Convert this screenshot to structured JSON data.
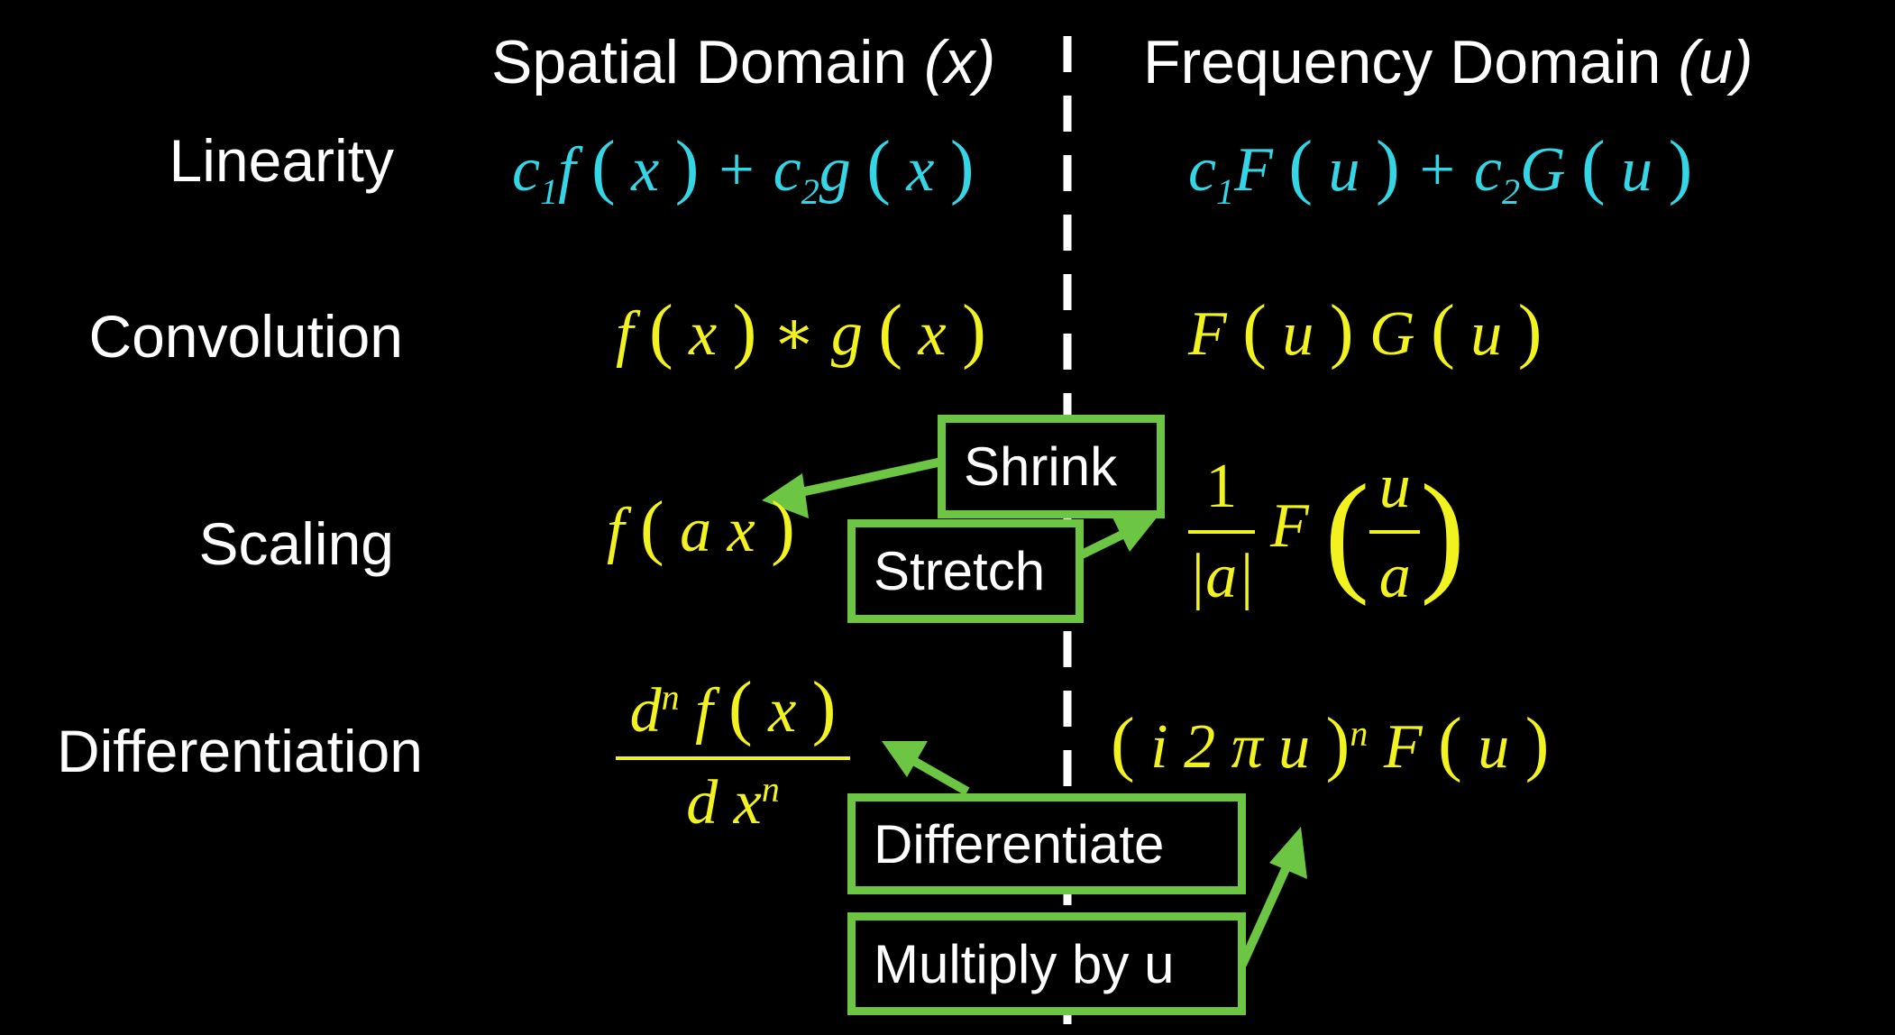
{
  "headers": {
    "spatial": "Spatial Domain",
    "spatial_var": "(x)",
    "frequency": "Frequency Domain",
    "frequency_var": "(u)"
  },
  "rows": {
    "linearity": "Linearity",
    "convolution": "Convolution",
    "scaling": "Scaling",
    "differentiation": "Differentiation"
  },
  "callouts": {
    "shrink": "Shrink",
    "stretch": "Stretch",
    "differentiate": "Differentiate",
    "multiply": "Multiply by u"
  },
  "colors": {
    "background": "#000000",
    "linearity_eq": "#34d6e6",
    "other_eq": "#f2f220",
    "callout_border": "#6cc644",
    "text": "#ffffff"
  }
}
